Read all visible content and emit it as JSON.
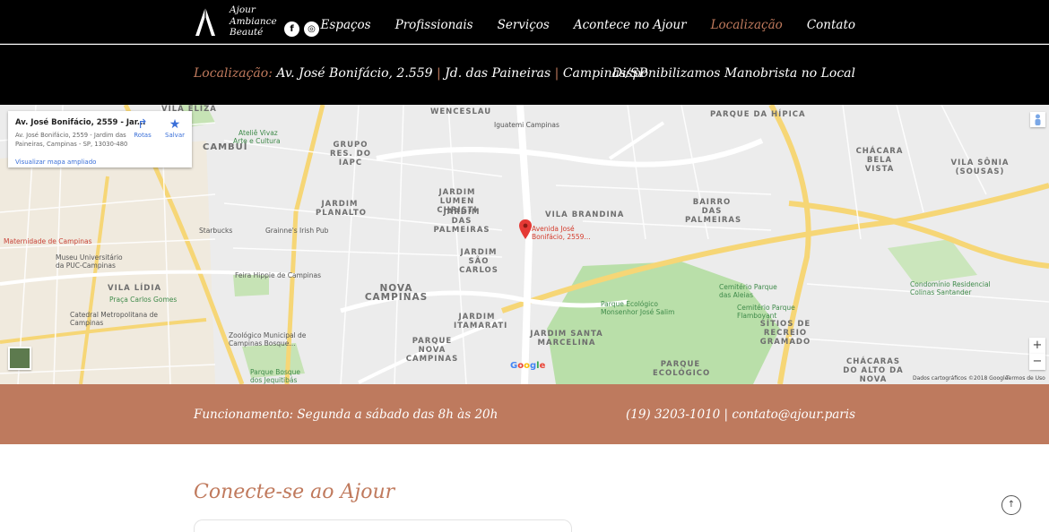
{
  "header": {
    "brand_lines": [
      "Ajour",
      "Ambiance",
      "Beauté"
    ],
    "social": [
      {
        "name": "facebook",
        "glyph": "f"
      },
      {
        "name": "instagram",
        "glyph": "◎"
      }
    ],
    "nav": [
      {
        "label": "Espaços",
        "active": false
      },
      {
        "label": "Profissionais",
        "active": false
      },
      {
        "label": "Serviços",
        "active": false
      },
      {
        "label": "Acontece no Ajour",
        "active": false
      },
      {
        "label": "Localização",
        "active": true
      },
      {
        "label": "Contato",
        "active": false
      }
    ]
  },
  "infobar": {
    "location_prefix": "Localização:",
    "address": "Av. José Bonifácio, 2.559",
    "separator": "|",
    "district": "Jd. das Paineiras",
    "city": "Campinas/SP",
    "valet": "Disponibilizamos Manobrista no Local"
  },
  "map": {
    "card": {
      "title": "Av. José Bonifácio, 2559 - Jar...",
      "address": "Av. José Bonifácio, 2559 - Jardim das Paineiras, Campinas - SP, 13030-480",
      "enlarge_link": "Visualizar mapa ampliado",
      "directions": "Rotas",
      "save": "Salvar"
    },
    "pin_label": "Avenida José Bonifácio, 2559...",
    "areas": [
      "PARQUE DA HÍPICA",
      "CHÁCARA BELA VISTA",
      "VILA SÔNIA (SOUSAS)",
      "BAIRRO DAS PALMEIRAS",
      "JARDIM LUMEN CHRISTI",
      "JARDIM DAS PALMEIRAS",
      "VILA BRANDINA",
      "JARDIM PLANALTO",
      "GRUPO RES. DO IAPC",
      "JARDIM SÃO CARLOS",
      "NOVA CAMPINAS",
      "JARDIM ITAMARATI",
      "PARQUE NOVA CAMPINAS",
      "JARDIM SANTA MARCELINA",
      "PARQUE ECOLÓGICO",
      "SÍTIOS DE RECREIO GRAMADO",
      "CHÁCARAS DO ALTO DA NOVA",
      "VILA LÍDIA",
      "CAMBUÍ",
      "VILA ELIZA",
      "WENCESLAU"
    ],
    "pois": [
      "Iguatemi Campinas",
      "Starbucks",
      "Grainne's Irish Pub",
      "Feira Hippie de Campinas",
      "Maternidade de Campinas",
      "Museu Universitário da PUC-Campinas",
      "Praça Carlos Gomes",
      "Catedral Metropolitana de Campinas",
      "Zoológico Municipal de Campinas Bosque...",
      "Parque Bosque dos Jequitibás",
      "Parque Ecológico Monsenhor José Salim",
      "Cemitério Parque das Aleias",
      "Cemitério Parque Flamboyant",
      "Condomínio Residencial Colinas Santander",
      "Arte e Cultura",
      "Ateliê Vivaz"
    ],
    "attribution": "Dados cartográficos ©2018 Google",
    "terms": "Termos de Uso",
    "google": "Google",
    "zoom_in": "+",
    "zoom_out": "−"
  },
  "hours": {
    "label": "Funcionamento: Segunda a sábado das 8h às 20h",
    "contact": "(19) 3203-1010 | contato@ajour.paris"
  },
  "connect": {
    "title": "Conecte-se ao Ajour"
  },
  "back_to_top": "↑",
  "colors": {
    "accent": "#c07a5d",
    "hours_bg": "#be7a5e",
    "header_bg": "#000000"
  }
}
